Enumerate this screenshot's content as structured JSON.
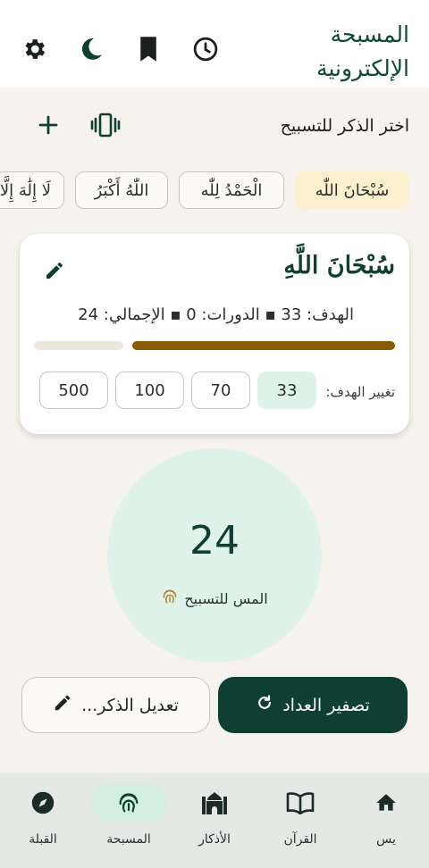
{
  "header": {
    "app_title": "المسبحة الإلكترونية",
    "icons": [
      "history-icon",
      "bookmark-icon",
      "dark-mode-icon",
      "settings-icon"
    ]
  },
  "section": {
    "title": "اختر الذكر للتسبيح",
    "icons": [
      "vibration-icon",
      "add-icon"
    ]
  },
  "chips": [
    {
      "label": "سُبْحَانَ اللّٰه",
      "active": true
    },
    {
      "label": "الْحَمْدُ لِلّٰه",
      "active": false
    },
    {
      "label": "اللّٰهُ أَكْبَرُ",
      "active": false
    },
    {
      "label": "لَا إِلَٰهَ إِلَّا اللّٰه",
      "active": false
    }
  ],
  "card": {
    "dhikr": "سُبْحَانَ اللَّهِ",
    "stats": "الهدف: 33 ▪ الدورات: 0 ▪ الإجمالي: 24",
    "progress": 0.727,
    "target_label": "تغيير الهدف:",
    "targets": [
      {
        "label": "33",
        "active": true
      },
      {
        "label": "70",
        "active": false
      },
      {
        "label": "100",
        "active": false
      },
      {
        "label": "500",
        "active": false
      }
    ]
  },
  "counter": {
    "value": "24",
    "hint": "المس للتسبيح"
  },
  "actions": {
    "reset_label": "تصفير العداد",
    "edit_label": "تعديل الذكر..."
  },
  "nav": [
    {
      "label": "يس",
      "icon": "home-icon",
      "active": false
    },
    {
      "label": "القرآن",
      "icon": "book-icon",
      "active": false
    },
    {
      "label": "الأذكار",
      "icon": "mosque-icon",
      "active": false
    },
    {
      "label": "المسبحة",
      "icon": "fingerprint-icon",
      "active": true
    },
    {
      "label": "القبلة",
      "icon": "compass-icon",
      "active": false
    }
  ],
  "colors": {
    "primary": "#0f3f32",
    "accent_gold": "#8a5a05",
    "mint": "#dff3ea",
    "chip_active": "#fdf0cf",
    "background": "#f6f3ee"
  }
}
